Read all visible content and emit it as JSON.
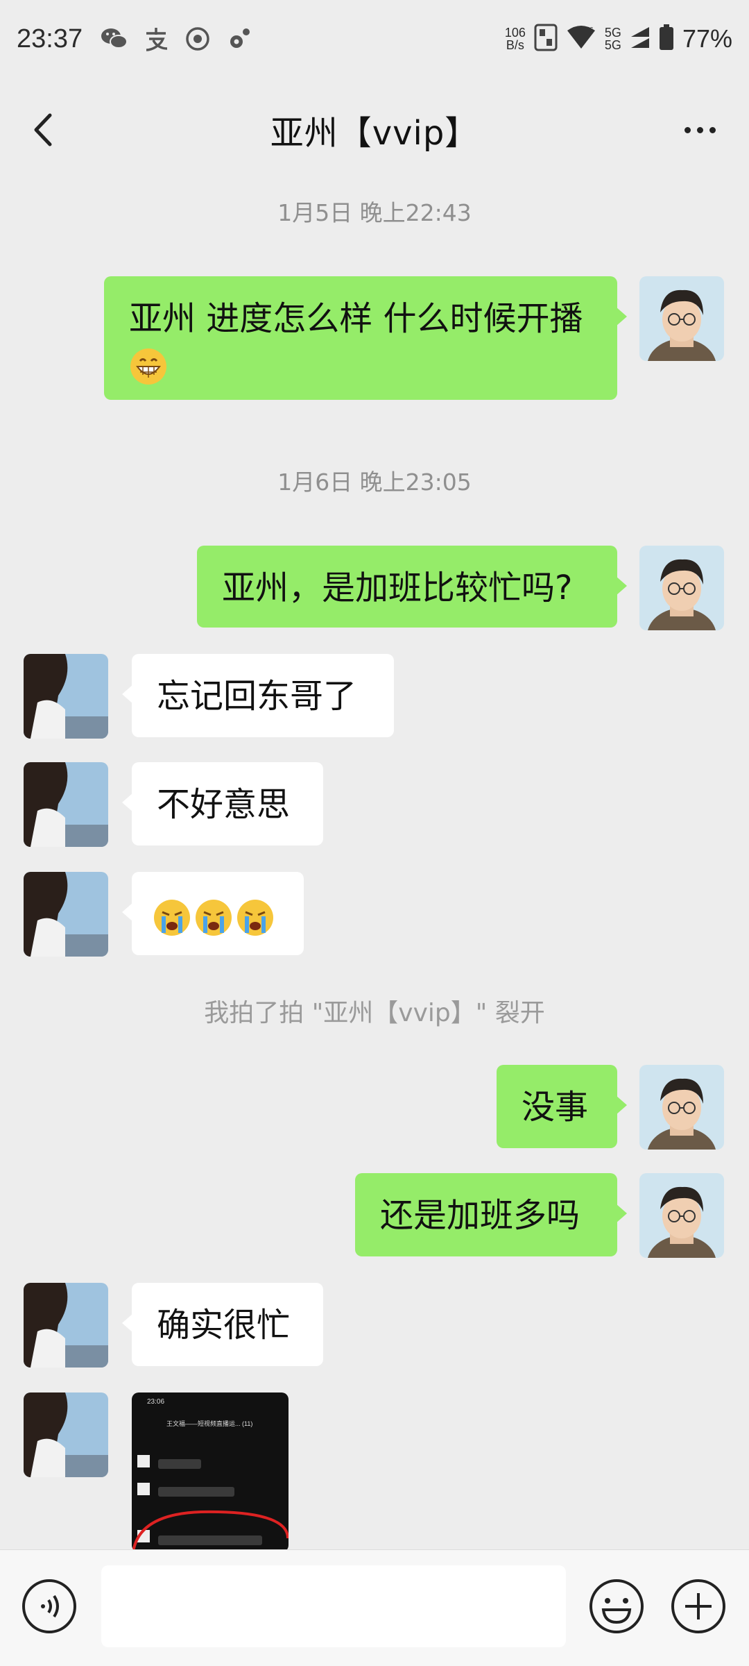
{
  "status_bar": {
    "time": "23:37",
    "net_speed_value": "106",
    "net_speed_unit": "B/s",
    "signal_top": "5G",
    "signal_bottom": "5G",
    "battery": "77%",
    "icons": [
      "wechat-icon",
      "alipay-icon",
      "record-icon",
      "settings-icon",
      "nfc-icon",
      "wifi-icon",
      "signal-icon",
      "battery-icon"
    ]
  },
  "header": {
    "title": "亚州【vvip】",
    "back_icon": "chevron-left-icon",
    "more_icon": "more-dots-icon"
  },
  "chat": {
    "timestamps": [
      "1月5日 晚上22:43",
      "1月6日 晚上23:05"
    ],
    "messages": [
      {
        "from": "me",
        "text": "亚州 进度怎么样 什么时候开播",
        "emoji": "grinning-face"
      },
      {
        "from": "me",
        "text": "亚州，是加班比较忙吗?"
      },
      {
        "from": "them",
        "text": "忘记回东哥了"
      },
      {
        "from": "them",
        "text": "不好意思"
      },
      {
        "from": "them",
        "emojis": [
          "crying-face",
          "crying-face",
          "crying-face"
        ]
      },
      {
        "from": "me",
        "text": "没事"
      },
      {
        "from": "me",
        "text": "还是加班多吗"
      },
      {
        "from": "them",
        "text": "确实很忙"
      },
      {
        "from": "them",
        "type": "image",
        "image_desc": "chat screenshot"
      }
    ],
    "pat_notice": "我拍了拍 \"亚州【vvip】\" 裂开"
  },
  "thumbnail": {
    "time": "23:06",
    "title": "王文福——短视频直播运... (11)"
  },
  "input_bar": {
    "placeholder": "",
    "voice_icon": "voice-icon",
    "emoji_icon": "emoji-icon",
    "plus_icon": "plus-circle-icon"
  },
  "colors": {
    "background": "#ededed",
    "my_bubble": "#95ec69",
    "their_bubble": "#ffffff",
    "timestamp_text": "#8f8f8f"
  }
}
